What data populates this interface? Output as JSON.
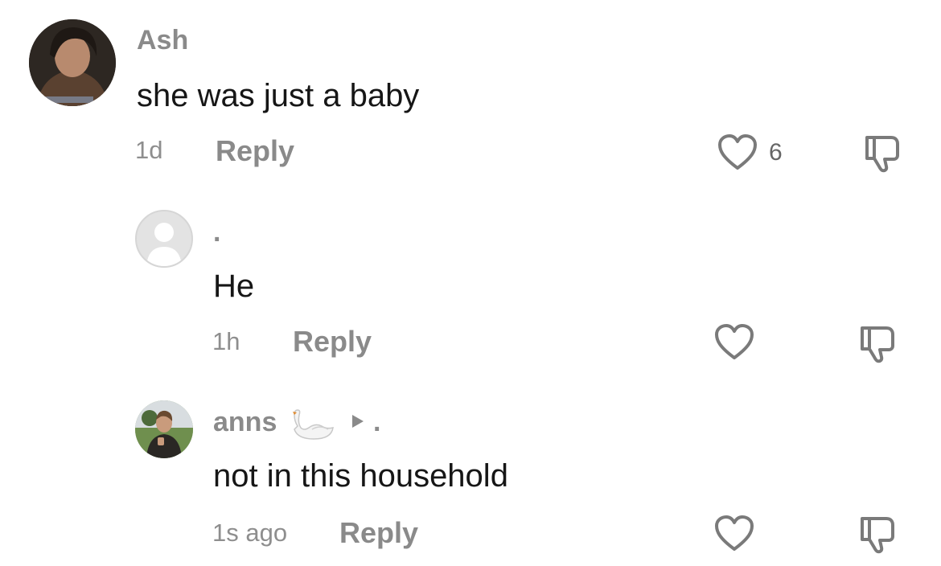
{
  "comments": [
    {
      "username": "Ash",
      "text": "she was just a baby",
      "time": "1d",
      "reply_label": "Reply",
      "like_count": "6",
      "avatar": "user-photo-dark-hair"
    },
    {
      "username": ".",
      "text": "He",
      "time": "1h",
      "reply_label": "Reply",
      "like_count": "",
      "avatar": "default-avatar"
    },
    {
      "username": "anns",
      "username_suffix": ".",
      "text": "not in this household",
      "time": "1s ago",
      "reply_label": "Reply",
      "like_count": "",
      "avatar": "user-photo-thumbs-up"
    }
  ],
  "icons": {
    "like": "heart-outline-icon",
    "dislike": "thumbs-down-icon",
    "swan": "swan-emoji",
    "reply_arrow": "triangle-right-icon"
  },
  "colors": {
    "text": "#161616",
    "muted": "#8a8a8a",
    "icon": "#7a7a7a"
  }
}
